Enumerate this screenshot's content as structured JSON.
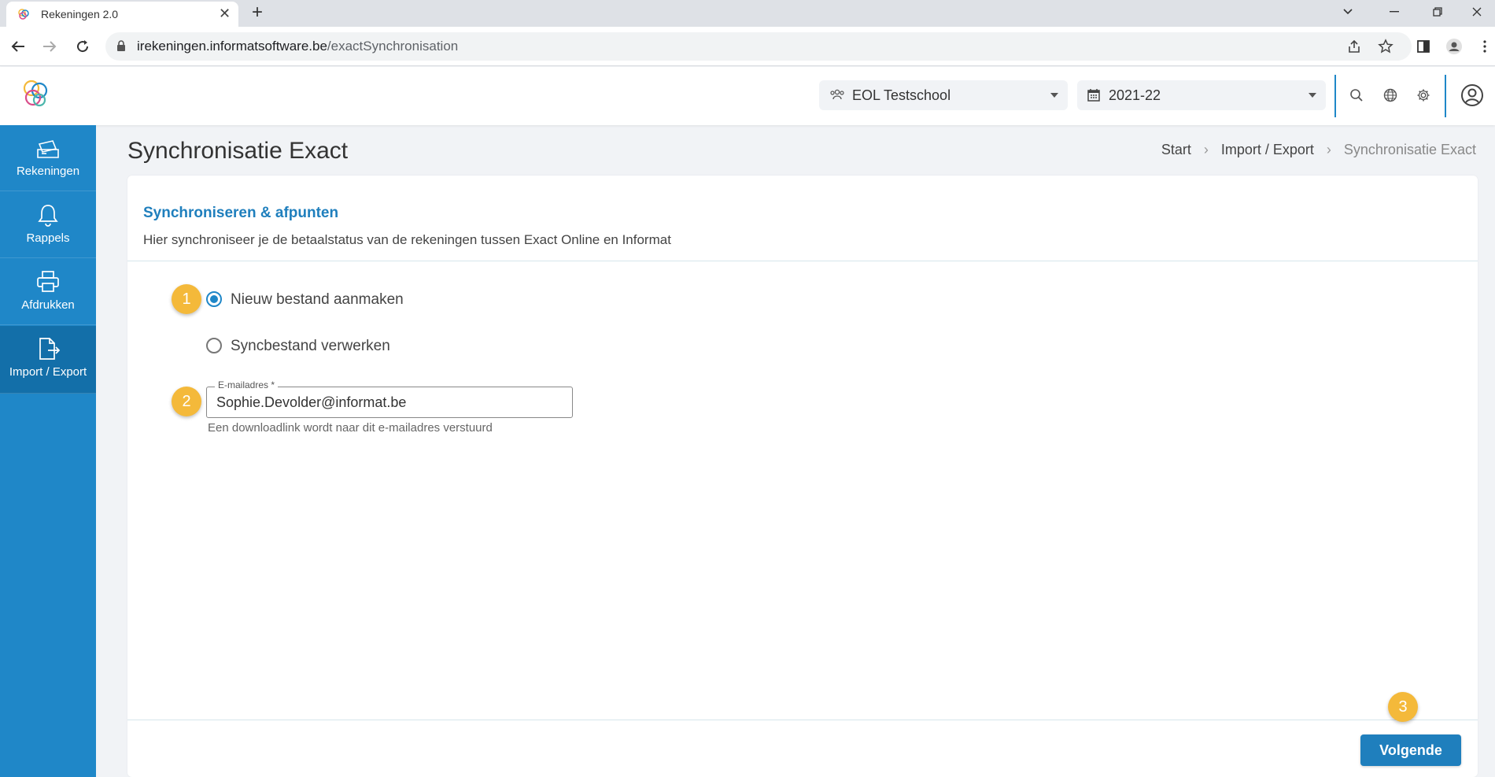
{
  "browser": {
    "tab_title": "Rekeningen 2.0",
    "url_domain": "irekeningen.informatsoftware.be",
    "url_path": "/exactSynchronisation"
  },
  "header": {
    "school_select": "EOL Testschool",
    "year_select": "2021-22"
  },
  "sidebar": {
    "items": [
      {
        "label": "Rekeningen",
        "icon": "invoice-icon"
      },
      {
        "label": "Rappels",
        "icon": "bell-icon"
      },
      {
        "label": "Afdrukken",
        "icon": "printer-icon"
      },
      {
        "label": "Import / Export",
        "icon": "file-export-icon",
        "active": true
      }
    ]
  },
  "page": {
    "title": "Synchronisatie Exact",
    "breadcrumb": [
      "Start",
      "Import / Export",
      "Synchronisatie Exact"
    ]
  },
  "card": {
    "title": "Synchroniseren & afpunten",
    "subtitle": "Hier synchroniseer je de betaalstatus van de rekeningen tussen Exact Online en Informat",
    "options": [
      {
        "label": "Nieuw bestand aanmaken",
        "checked": true
      },
      {
        "label": "Syncbestand verwerken",
        "checked": false
      }
    ],
    "email_label": "E-mailadres *",
    "email_value": "Sophie.Devolder@informat.be",
    "email_help": "Een downloadlink wordt naar dit e-mailadres verstuurd",
    "next_button": "Volgende"
  },
  "markers": [
    "1",
    "2",
    "3"
  ],
  "colors": {
    "primary": "#1f87c8",
    "sidebar_active": "#136fa9",
    "marker": "#f4b93a"
  }
}
